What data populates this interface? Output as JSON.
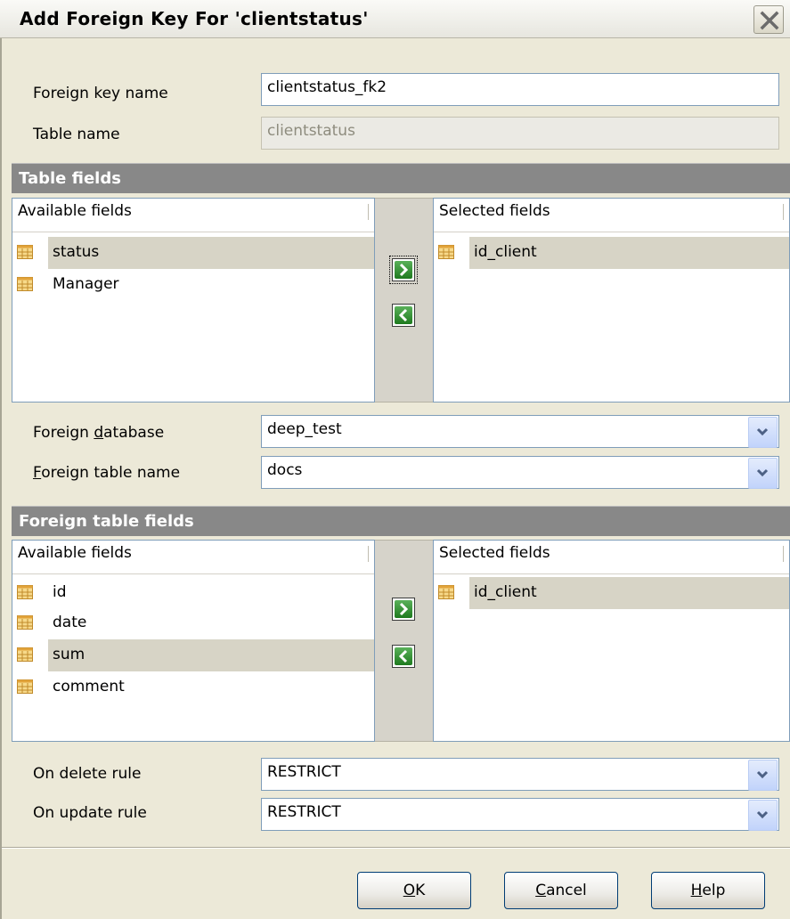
{
  "window": {
    "title": "Add Foreign Key For 'clientstatus'"
  },
  "fk_name": {
    "label": "Foreign key name",
    "value": "clientstatus_fk2"
  },
  "table_name": {
    "label": "Table name",
    "value": "clientstatus"
  },
  "table_fields": {
    "section_title": "Table fields",
    "available_header": "Available fields",
    "selected_header": "Selected fields",
    "available": [
      "status",
      "Manager"
    ],
    "selected": [
      "id_client"
    ]
  },
  "foreign_db": {
    "label_pre": "Foreign ",
    "label_key": "d",
    "label_post": "atabase",
    "value": "deep_test"
  },
  "foreign_table": {
    "label_key": "F",
    "label_post": "oreign table name",
    "value": "docs"
  },
  "foreign_fields": {
    "section_title": "Foreign table fields",
    "available_header": "Available fields",
    "selected_header": "Selected fields",
    "available": [
      "id",
      "date",
      "sum",
      "comment"
    ],
    "selected": [
      "id_client"
    ]
  },
  "on_delete": {
    "label": "On delete rule",
    "value": "RESTRICT"
  },
  "on_update": {
    "label": "On update rule",
    "value": "RESTRICT"
  },
  "buttons": {
    "ok_key": "O",
    "ok_rest": "K",
    "cancel_key": "C",
    "cancel_rest": "ancel",
    "help_key": "H",
    "help_rest": "elp"
  },
  "icons": {
    "field": "table-field-icon",
    "add": "arrow-right-icon",
    "remove": "arrow-left-icon",
    "close": "close-icon",
    "dropdown": "chevron-down-icon"
  },
  "colors": {
    "section": "#888888",
    "selection": "#d7d4c6",
    "arrow_button": "#2e8b2e",
    "close_button": "#c0c0c0"
  }
}
